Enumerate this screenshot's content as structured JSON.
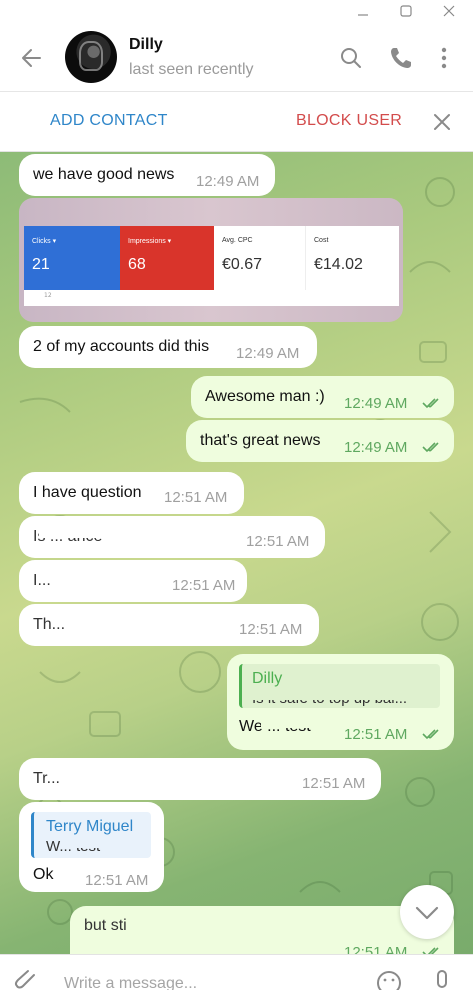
{
  "window": {
    "controls": [
      "minimize",
      "maximize",
      "close"
    ]
  },
  "header": {
    "contact_name": "Dilly",
    "status": "last seen recently",
    "icons": [
      "back-arrow-icon",
      "search-icon",
      "phone-icon",
      "more-vertical-icon"
    ]
  },
  "actionbar": {
    "add_contact": "ADD CONTACT",
    "block_user": "BLOCK USER"
  },
  "messages": [
    {
      "dir": "in",
      "text": "we have good news",
      "time": "12:49 AM"
    },
    {
      "dir": "in",
      "type": "image",
      "metrics": [
        {
          "label": "Clicks ▾",
          "value": "21"
        },
        {
          "label": "Impressions ▾",
          "value": "68"
        },
        {
          "label": "Avg. CPC",
          "value": "€0.67"
        },
        {
          "label": "Cost",
          "value": "€14.02"
        }
      ],
      "axis_label": "12"
    },
    {
      "dir": "in",
      "text": "2 of my accounts did this",
      "time": "12:49 AM"
    },
    {
      "dir": "out",
      "text": "Awesome man :)",
      "time": "12:49 AM"
    },
    {
      "dir": "out",
      "text": "that's great news",
      "time": "12:49 AM"
    },
    {
      "dir": "in",
      "text": "I have question",
      "time": "12:51 AM"
    },
    {
      "dir": "in",
      "text": "Is ... ance",
      "time": "12:51 AM",
      "redacted": true
    },
    {
      "dir": "in",
      "text": "I...",
      "time": "12:51 AM",
      "redacted": true
    },
    {
      "dir": "in",
      "text": "Th...",
      "time": "12:51 AM",
      "redacted": true
    },
    {
      "dir": "out",
      "reply_to": "Dilly",
      "reply_text": "Is it safe to top up bal...",
      "text": "We ... test",
      "time": "12:51 AM",
      "redacted": true
    },
    {
      "dir": "in",
      "text": "Tr...",
      "time": "12:51 AM",
      "redacted": true
    },
    {
      "dir": "in",
      "reply_to": "Terry Miguel",
      "reply_text": "W... test",
      "text": "Ok",
      "time": "12:51 AM"
    },
    {
      "dir": "out",
      "text": "but still ... that won't be issues",
      "time": "12:51 AM",
      "redacted": true
    }
  ],
  "composer": {
    "placeholder": "Write a message..."
  }
}
